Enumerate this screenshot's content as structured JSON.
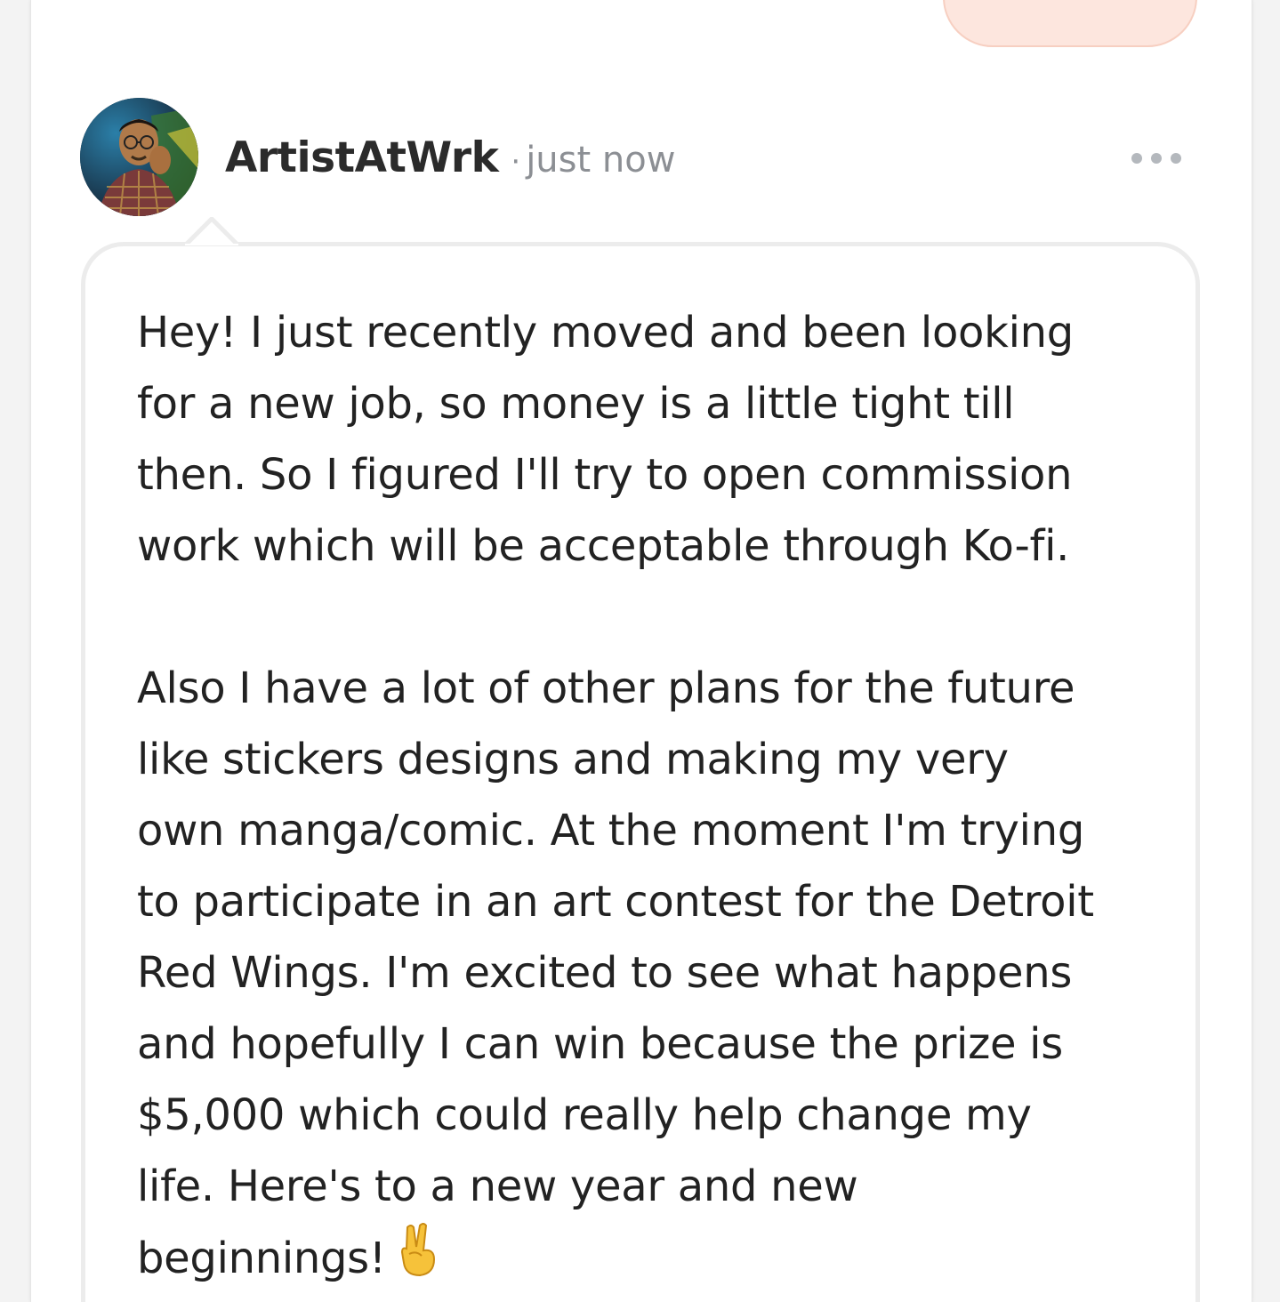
{
  "post": {
    "author": "ArtistAtWrk",
    "separator": "·",
    "timestamp": "just now",
    "paragraph_1": "Hey! I just recently moved and been looking\nfor a new job, so money is a little tight till\nthen. So I figured I'll try to open commission\nwork which will be acceptable through Ko-fi.",
    "paragraph_2": "Also I have a lot of other plans for the future\nlike stickers designs and making my very\nown manga/comic. At the moment I'm trying\nto participate in an art contest for the Detroit\nRed Wings. I'm excited to see what happens\nand hopefully I can win because the prize is\n$5,000 which could really help change my\nlife. Here's to a new year and new\nbeginnings!",
    "emoji": "victory-hand-icon"
  },
  "icons": {
    "more": "more-horizontal-icon",
    "avatar": "avatar"
  },
  "colors": {
    "peach_button": "#fde6de",
    "text": "#222222",
    "muted": "#8c8f94",
    "bubble_border": "#ececec"
  }
}
